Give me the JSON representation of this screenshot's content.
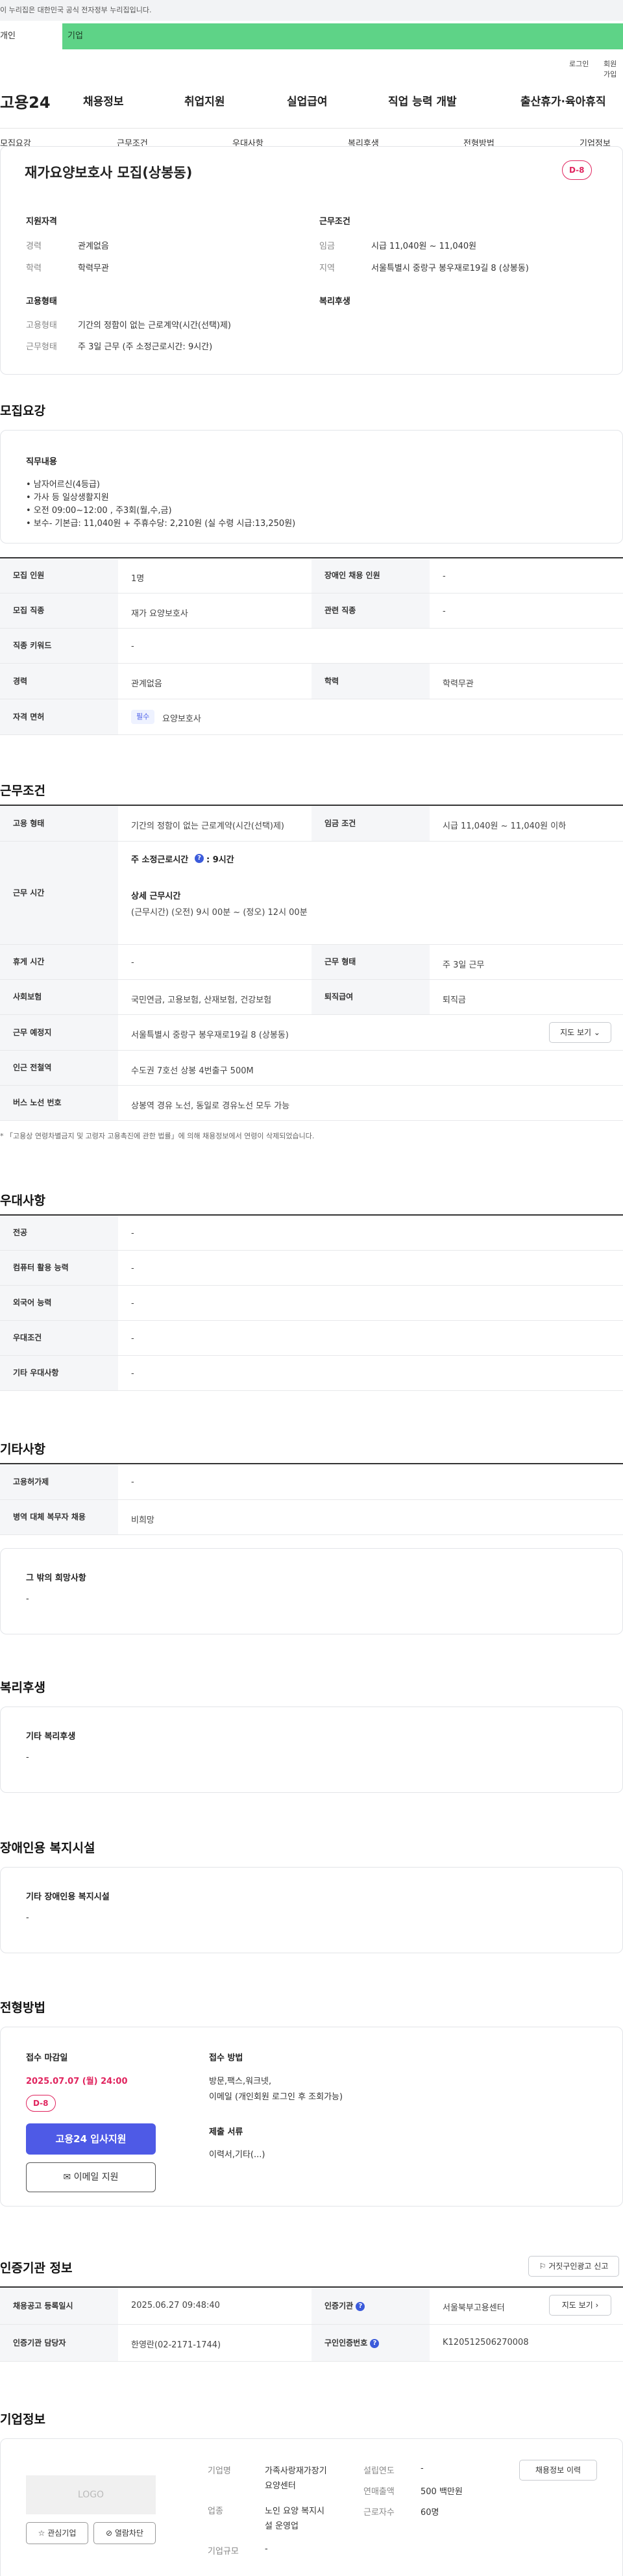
{
  "gov_banner": "이 누리집은 대한민국 공식 전자정부 누리집입니다.",
  "biz_tabs": {
    "personal": "개인",
    "company": "기업"
  },
  "util": {
    "login": "로그인",
    "signup": "회원가입"
  },
  "logo": "고용24",
  "gnb": [
    "채용정보",
    "취업지원",
    "실업급여",
    "직업 능력 개발",
    "출산휴가·육아휴직"
  ],
  "lnb": [
    "모집요강",
    "근무조건",
    "우대사항",
    "복리후생",
    "전형방법",
    "기업정보"
  ],
  "job": {
    "title": "재가요양보호사 모집(상봉동)",
    "dday": "D-8",
    "qual_heading": "지원자격",
    "career_label": "경력",
    "career_value": "관계없음",
    "edu_label": "학력",
    "edu_value": "학력무관",
    "cond_heading": "근무조건",
    "wage_label": "임금",
    "wage_value": "시급 11,040원 ~ 11,040원",
    "region_label": "지역",
    "region_value": "서울특별시 중랑구 봉우재로19길 8 (상봉동)",
    "emp_heading": "고용형태",
    "emp_type_label": "고용형태",
    "emp_type_value": "기간의 정함이 없는 근로계약(시간(선택)제)",
    "work_type_label": "근무형태",
    "work_type_value": "주 3일 근무 (주 소정근로시간: 9시간)",
    "welfare_heading": "복리후생"
  },
  "recruit": {
    "heading": "모집요강",
    "duty_heading": "직무내용",
    "duties": [
      "• 남자어르신(4등급)",
      "• 가사 등 일상생활지원",
      "• 오전 09:00~12:00 , 주3회(월,수,금)",
      "• 보수- 기본급: 11,040원 + 주휴수당: 2,210원 (실 수령 시급:13,250원)"
    ],
    "count_label": "모집 인원",
    "count_value": "1명",
    "disabled_label": "장애인 채용 인원",
    "disabled_value": "-",
    "job_label": "모집 직종",
    "job_value": "재가 요양보호사",
    "related_label": "관련 직종",
    "related_value": "-",
    "keyword_label": "직종 키워드",
    "keyword_value": "-",
    "career_label": "경력",
    "career_value": "관계없음",
    "edu_label": "학력",
    "edu_value": "학력무관",
    "license_label": "자격 면허",
    "license_tag": "필수",
    "license_value": "요양보호사"
  },
  "conditions": {
    "heading": "근무조건",
    "emp_label": "고용 형태",
    "emp_value": "기간의 정함이 없는 근로계약(시간(선택)제)",
    "wage_label": "임금 조건",
    "wage_value": "시급 11,040원 ~ 11,040원 이하",
    "time_label": "근무 시간",
    "weekly_label": "주 소정근로시간",
    "weekly_value": ": 9시간",
    "detail_label": "상세 근무시간",
    "detail_value": "(근무시간) (오전) 9시 00분 ~ (정오) 12시 00분",
    "break_label": "휴게 시간",
    "break_value": "-",
    "worktype_label": "근무 형태",
    "worktype_value": "주 3일 근무",
    "insurance_label": "사회보험",
    "insurance_value": "국민연금, 고용보험, 산재보험, 건강보험",
    "retire_label": "퇴직급여",
    "retire_value": "퇴직금",
    "place_label": "근무 예정지",
    "place_value": "서울특별시 중랑구 봉우재로19길 8 (상봉동)",
    "map_btn": "지도 보기 ⌄",
    "subway_label": "인근 전철역",
    "subway_value": "수도권 7호선 상봉 4번출구 500M",
    "bus_label": "버스 노선 번호",
    "bus_value": "상봉역 경유 노선, 동일로 경유노선 모두 가능",
    "note": "* 「고용상 연령차별금지 및 고령자 고용촉진에 관한 법률」에 의해 채용정보에서 연령이 삭제되었습니다."
  },
  "prefer": {
    "heading": "우대사항",
    "rows": [
      {
        "label": "전공",
        "value": "-"
      },
      {
        "label": "컴퓨터 활용 능력",
        "value": "-"
      },
      {
        "label": "외국어 능력",
        "value": "-"
      },
      {
        "label": "우대조건",
        "value": "-"
      },
      {
        "label": "기타 우대사항",
        "value": "-"
      }
    ]
  },
  "etc": {
    "heading": "기타사항",
    "hire_label": "고용허가제",
    "hire_value": "-",
    "military_label": "병역 대체 복무자 채용",
    "military_value": "비희망",
    "other_heading": "그 밖의 희망사항",
    "other_value": "-"
  },
  "welfare": {
    "heading": "복리후생",
    "sub": "기타 복리후생",
    "value": "-"
  },
  "facility": {
    "heading": "장애인용 복지시설",
    "sub": "기타 장애인용 복지시설",
    "value": "-"
  },
  "selection": {
    "heading": "전형방법",
    "deadline_label": "접수 마감일",
    "deadline_value": "2025.07.07 (월) 24:00",
    "dday": "D-8",
    "apply_btn": "고용24 입사지원",
    "email_btn": "이메일 지원",
    "method_label": "접수 방법",
    "method_value1": "방문,팩스,워크넷,",
    "method_value2": "이메일 (개인회원 로그인 후 조회가능)",
    "docs_label": "제출 서류",
    "docs_value": "이력서,기타(...)"
  },
  "agency": {
    "heading": "인증기관 정보",
    "report_btn": "거짓구인광고 신고",
    "reg_label": "채용공고 등록일시",
    "reg_value": "2025.06.27 09:48:40",
    "org_label": "인증기관",
    "org_value": "서울북부고용센터",
    "map_btn": "지도 보기 ›",
    "mgr_label": "인증기관 담당자",
    "mgr_value": "한영란(02-2171-1744)",
    "num_label": "구인인증번호",
    "num_value": "K120512506270008"
  },
  "company": {
    "heading": "기업정보",
    "logo_placeholder": "LOGO",
    "interest_btn": "관심기업",
    "block_btn": "열람차단",
    "history_btn": "채용정보 이력",
    "name_label": "기업명",
    "name_value1": "가족사랑재가장기",
    "name_value2": "요양센터",
    "industry_label": "업종",
    "industry_value1": "노인 요양 복지시",
    "industry_value2": "설 운영업",
    "scale_label": "기업규모",
    "scale_value": "-",
    "founded_label": "설립연도",
    "founded_value": "-",
    "sales_label": "연매출액",
    "sales_value": "500 백만원",
    "staff_label": "근로자수",
    "staff_value": "60명"
  }
}
